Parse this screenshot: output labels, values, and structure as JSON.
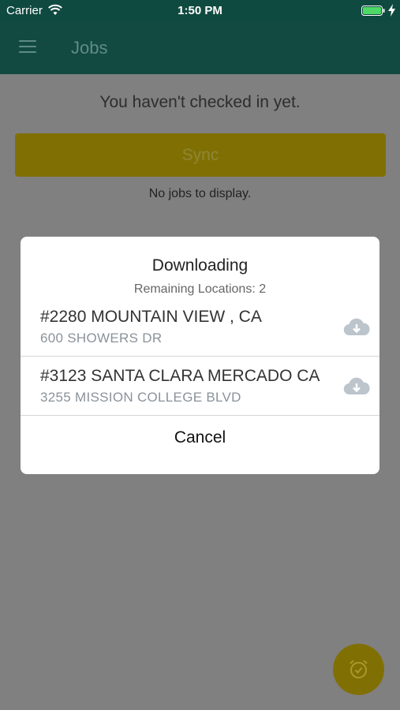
{
  "status_bar": {
    "carrier": "Carrier",
    "time": "1:50 PM",
    "battery_color": "#4cd964"
  },
  "nav": {
    "title": "Jobs"
  },
  "main": {
    "checkin_message": "You haven't checked in yet.",
    "sync_label": "Sync",
    "empty_message": "No jobs to display."
  },
  "dialog": {
    "title": "Downloading",
    "subtitle": "Remaining Locations: 2",
    "locations": [
      {
        "name": "#2280 MOUNTAIN VIEW , CA",
        "address": "600 SHOWERS DR",
        "icon": "cloud-download-icon"
      },
      {
        "name": "#3123 SANTA CLARA MERCADO CA",
        "address": "3255 MISSION COLLEGE BLVD",
        "icon": "cloud-download-icon"
      }
    ],
    "cancel_label": "Cancel"
  },
  "colors": {
    "header": "#124a41",
    "accent_yellow": "#807004",
    "overlay": "#808080"
  }
}
